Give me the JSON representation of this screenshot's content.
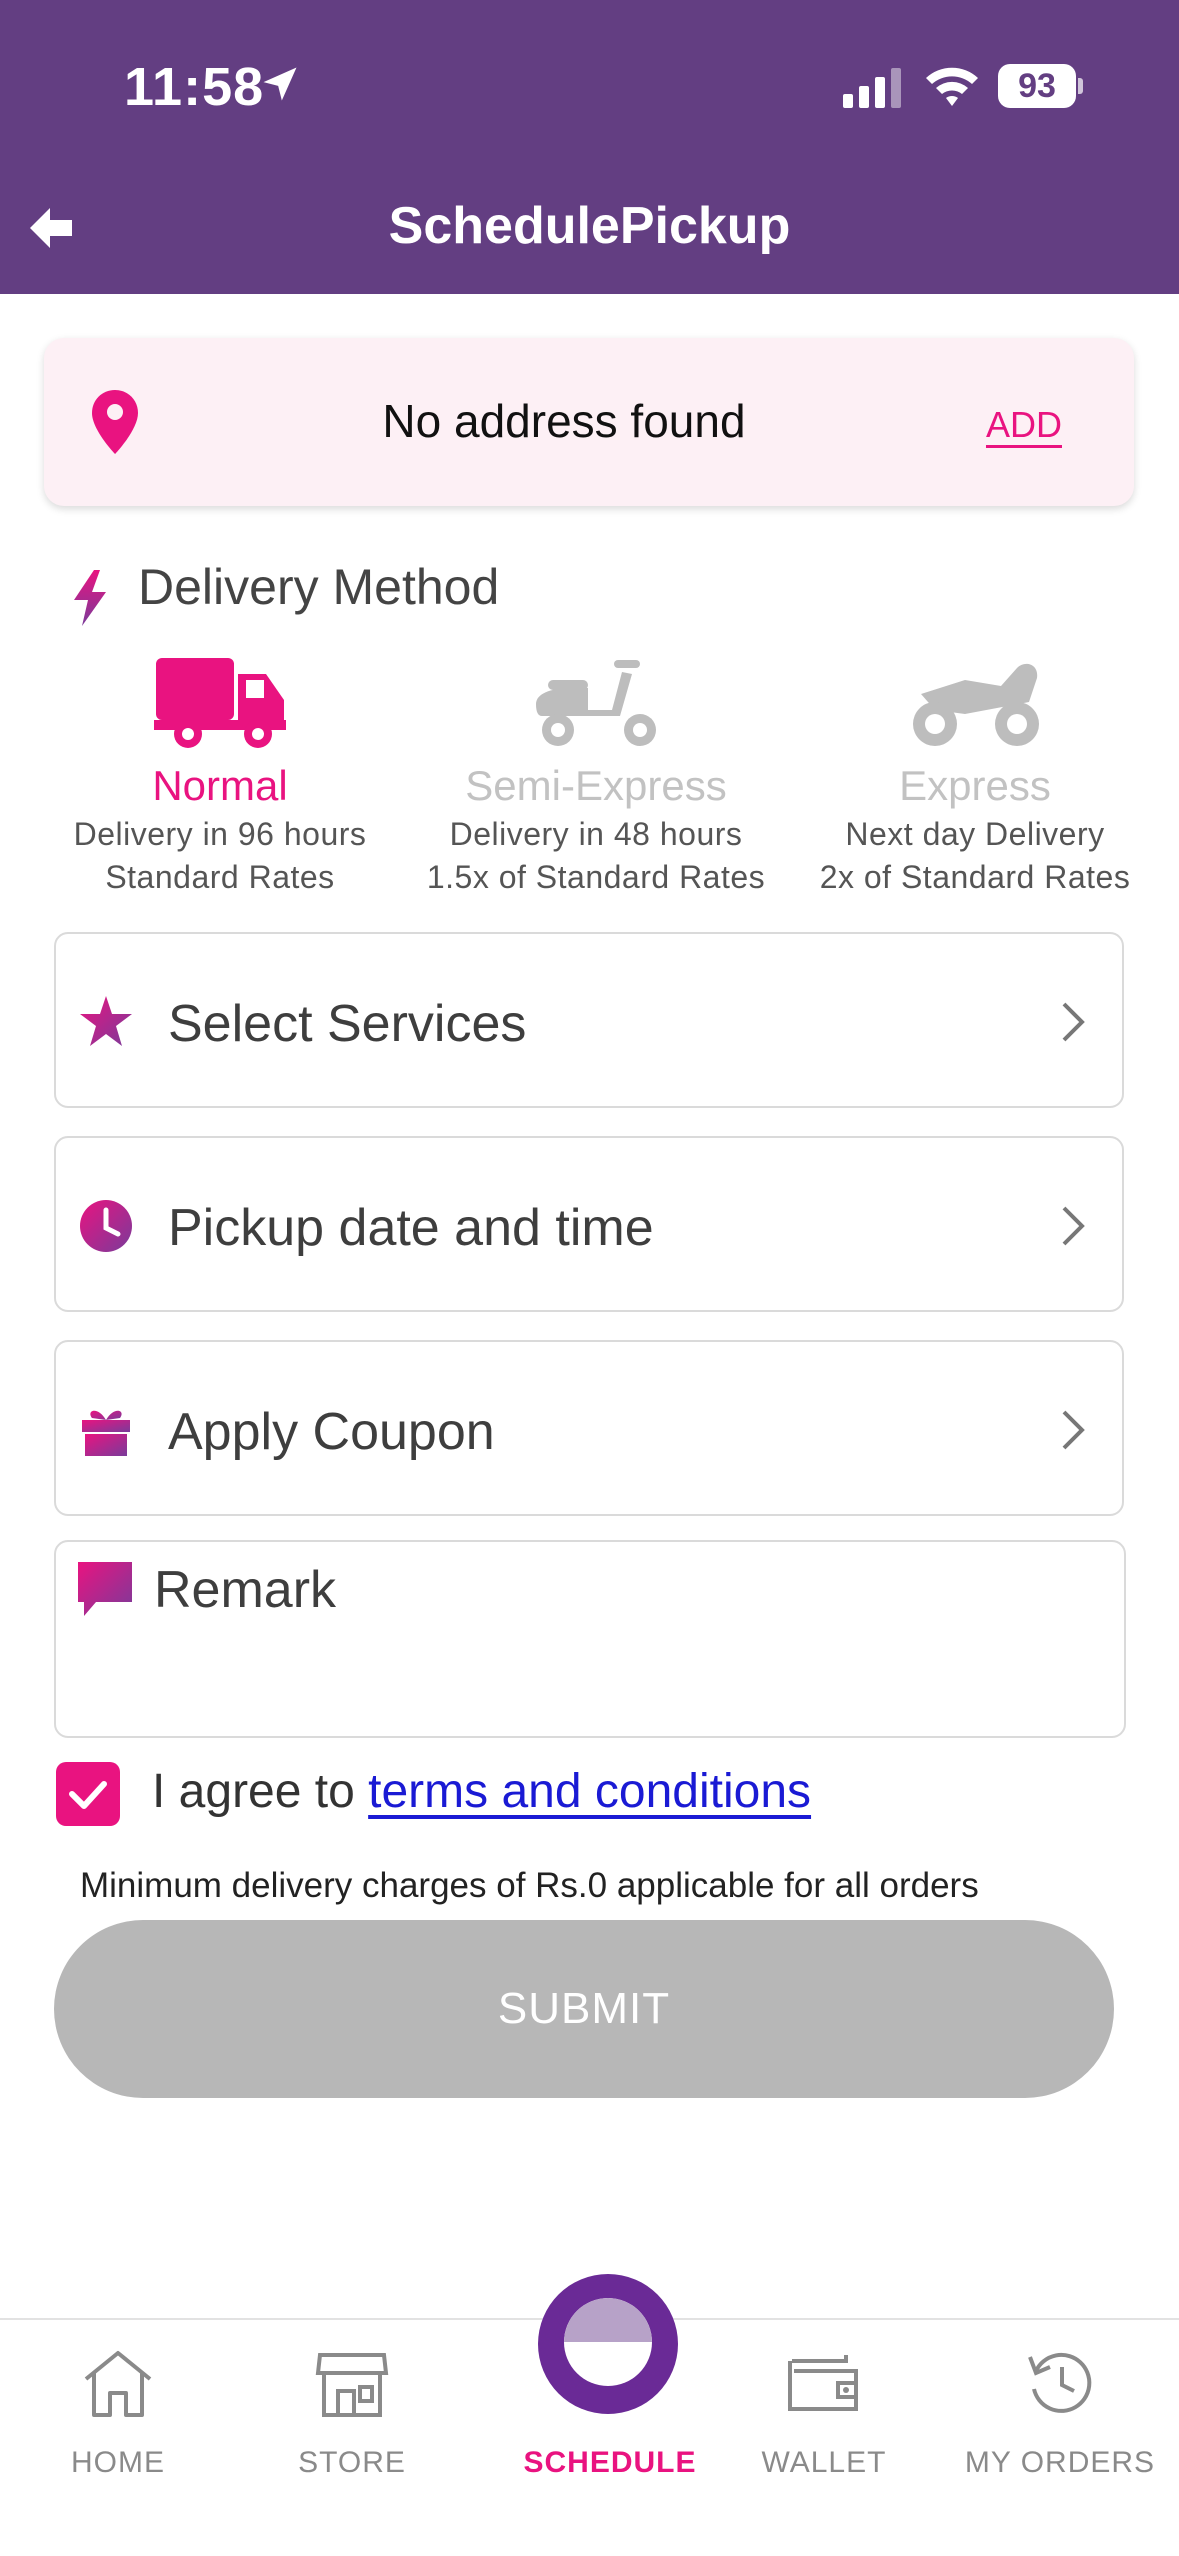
{
  "status_bar": {
    "time": "11:58",
    "battery": "93"
  },
  "header": {
    "title": "SchedulePickup"
  },
  "address": {
    "text": "No address found",
    "add_label": "ADD"
  },
  "delivery": {
    "heading": "Delivery Method",
    "methods": [
      {
        "name": "Normal",
        "line1": "Delivery in 96 hours",
        "line2": "Standard Rates",
        "icon": "truck-icon",
        "selected": true
      },
      {
        "name": "Semi-Express",
        "line1": "Delivery in 48 hours",
        "line2": "1.5x of Standard Rates",
        "icon": "scooter-icon",
        "selected": false
      },
      {
        "name": "Express",
        "line1": "Next day Delivery",
        "line2": "2x of Standard Rates",
        "icon": "motorbike-icon",
        "selected": false
      }
    ]
  },
  "rows": {
    "services": "Select Services",
    "pickup": "Pickup date and time",
    "coupon": "Apply Coupon",
    "remark": "Remark"
  },
  "terms": {
    "prefix": "I agree to ",
    "link": "terms and conditions",
    "checked": true
  },
  "note": "Minimum delivery charges of Rs.0 applicable for all orders",
  "submit_label": "SUBMIT",
  "nav": {
    "home": "HOME",
    "store": "STORE",
    "schedule": "SCHEDULE",
    "wallet": "WALLET",
    "orders": "MY ORDERS"
  },
  "colors": {
    "header": "#633e82",
    "accent": "#e91380",
    "link": "#1a1ad4",
    "disabled": "#b7b7b7"
  }
}
